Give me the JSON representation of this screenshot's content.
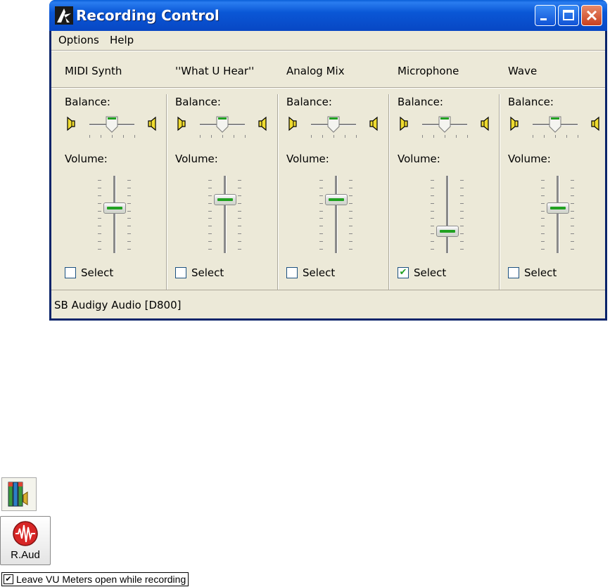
{
  "window": {
    "title": "Recording Control",
    "menu": [
      "Options",
      "Help"
    ],
    "status": "SB Audigy Audio [D800]"
  },
  "labels": {
    "balance": "Balance:",
    "volume": "Volume:",
    "select": "Select"
  },
  "channels": [
    {
      "name": "MIDI Synth",
      "balance": 0.5,
      "volume": 0.6,
      "selected": false
    },
    {
      "name": "''What U Hear''",
      "balance": 0.5,
      "volume": 0.72,
      "selected": false
    },
    {
      "name": "Analog Mix",
      "balance": 0.5,
      "volume": 0.72,
      "selected": false
    },
    {
      "name": "Microphone",
      "balance": 0.5,
      "volume": 0.25,
      "selected": true
    },
    {
      "name": "Wave",
      "balance": 0.5,
      "volume": 0.6,
      "selected": false
    }
  ],
  "tools": {
    "rec_audio_label": "R.Aud",
    "vu_option": {
      "label": "Leave VU Meters open while recording",
      "checked": true
    }
  }
}
